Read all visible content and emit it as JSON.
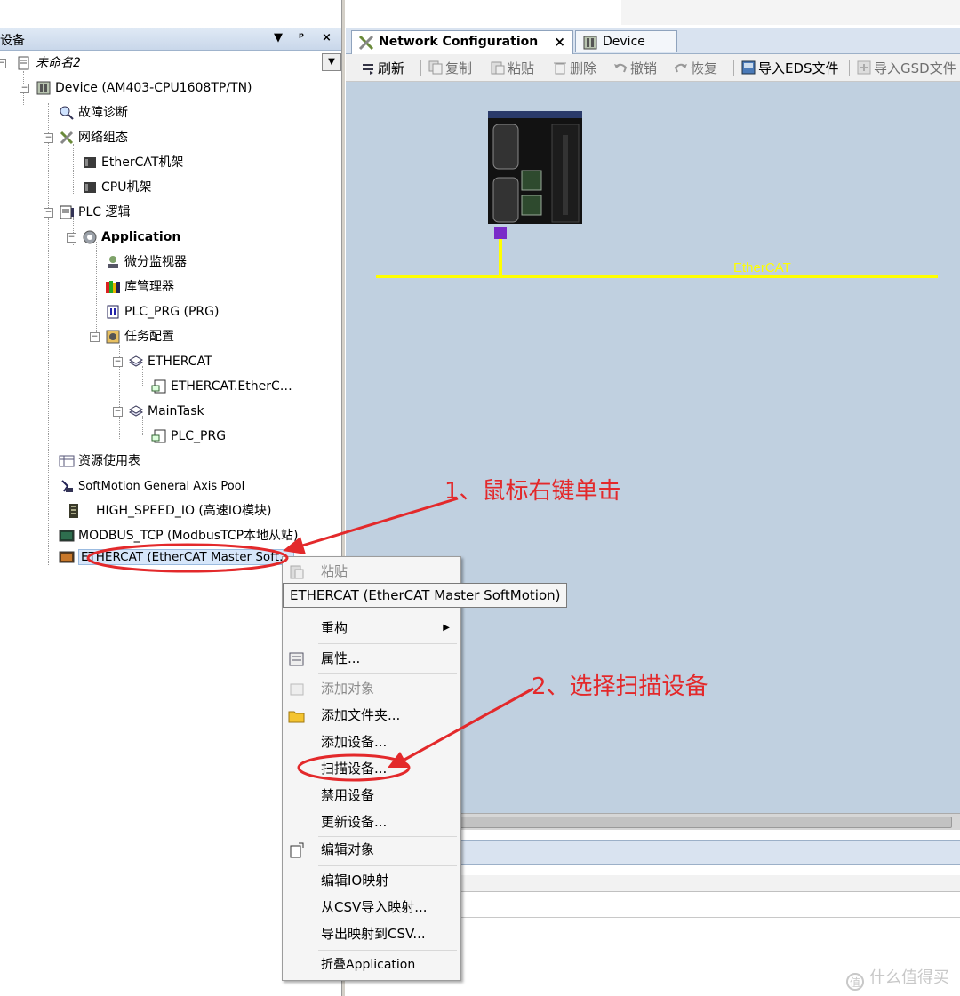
{
  "left_panel": {
    "title": "设备",
    "controls": [
      "▼",
      "ᵖ",
      "×"
    ],
    "dropdown": "▼"
  },
  "tree": [
    {
      "label": "未命名2",
      "icon": "project-icon"
    },
    {
      "label": "Device (AM403-CPU1608TP/TN)",
      "icon": "device-icon"
    },
    {
      "label": "故障诊断",
      "icon": "diagnosis-icon"
    },
    {
      "label": "网络组态",
      "icon": "network-config-icon"
    },
    {
      "label": "EtherCAT机架",
      "icon": "rack-icon"
    },
    {
      "label": "CPU机架",
      "icon": "rack-icon"
    },
    {
      "label": "PLC 逻辑",
      "icon": "plc-logic-icon"
    },
    {
      "label": "Application",
      "icon": "application-gear-icon"
    },
    {
      "label": "微分监视器",
      "icon": "monitor-icon"
    },
    {
      "label": "库管理器",
      "icon": "library-icon"
    },
    {
      "label": "PLC_PRG (PRG)",
      "icon": "program-icon"
    },
    {
      "label": "任务配置",
      "icon": "task-config-icon"
    },
    {
      "label": "ETHERCAT",
      "icon": "task-icon"
    },
    {
      "label": "ETHERCAT.EtherC…",
      "icon": "call-icon"
    },
    {
      "label": "MainTask",
      "icon": "task-icon"
    },
    {
      "label": "PLC_PRG",
      "icon": "call-icon"
    },
    {
      "label": "资源使用表",
      "icon": "table-icon"
    },
    {
      "label": "SoftMotion General Axis Pool",
      "icon": "axis-pool-icon"
    },
    {
      "label": "HIGH_SPEED_IO (高速IO模块)",
      "icon": "io-module-icon"
    },
    {
      "label": "MODBUS_TCP (ModbusTCP本地从站)",
      "icon": "modbus-icon"
    },
    {
      "label": "ETHERCAT (EtherCAT Master Soft…",
      "icon": "ethercat-master-icon"
    }
  ],
  "tabs": [
    {
      "label": "Network Configuration",
      "close": "×"
    },
    {
      "label": "Device"
    }
  ],
  "toolbar": [
    {
      "label": "刷新",
      "icon": "refresh-icon"
    },
    {
      "label": "复制",
      "icon": "copy-icon"
    },
    {
      "label": "粘贴",
      "icon": "paste-icon"
    },
    {
      "label": "删除",
      "icon": "delete-icon"
    },
    {
      "label": "撤销",
      "icon": "undo-icon"
    },
    {
      "label": "恢复",
      "icon": "redo-icon"
    },
    {
      "label": "导入EDS文件",
      "icon": "import-eds-icon"
    },
    {
      "label": "导入GSD文件",
      "icon": "import-gsd-icon"
    }
  ],
  "canvas": {
    "bus_label": "EtherCAT",
    "bus_color": "#ffff00",
    "background": "#c0d0e0"
  },
  "context_menu": {
    "items": [
      {
        "label": "粘贴",
        "disabled": true
      },
      {
        "label": "重构",
        "submenu": "▶"
      },
      {
        "label": "属性..."
      },
      {
        "label": "添加对象",
        "disabled": true
      },
      {
        "label": "添加文件夹..."
      },
      {
        "label": "添加设备..."
      },
      {
        "label": "扫描设备..."
      },
      {
        "label": "禁用设备"
      },
      {
        "label": "更新设备..."
      },
      {
        "label": "编辑对象"
      },
      {
        "label": "编辑IO映射"
      },
      {
        "label": "从CSV导入映射..."
      },
      {
        "label": "导出映射到CSV..."
      },
      {
        "label": "折叠Application"
      }
    ],
    "tooltip": "ETHERCAT (EtherCAT Master SoftMotion)"
  },
  "annotations": {
    "step1": "1、鼠标右键单击",
    "step2": "2、选择扫描设备",
    "color": "#e3292b"
  },
  "watermark": "什么值得买"
}
